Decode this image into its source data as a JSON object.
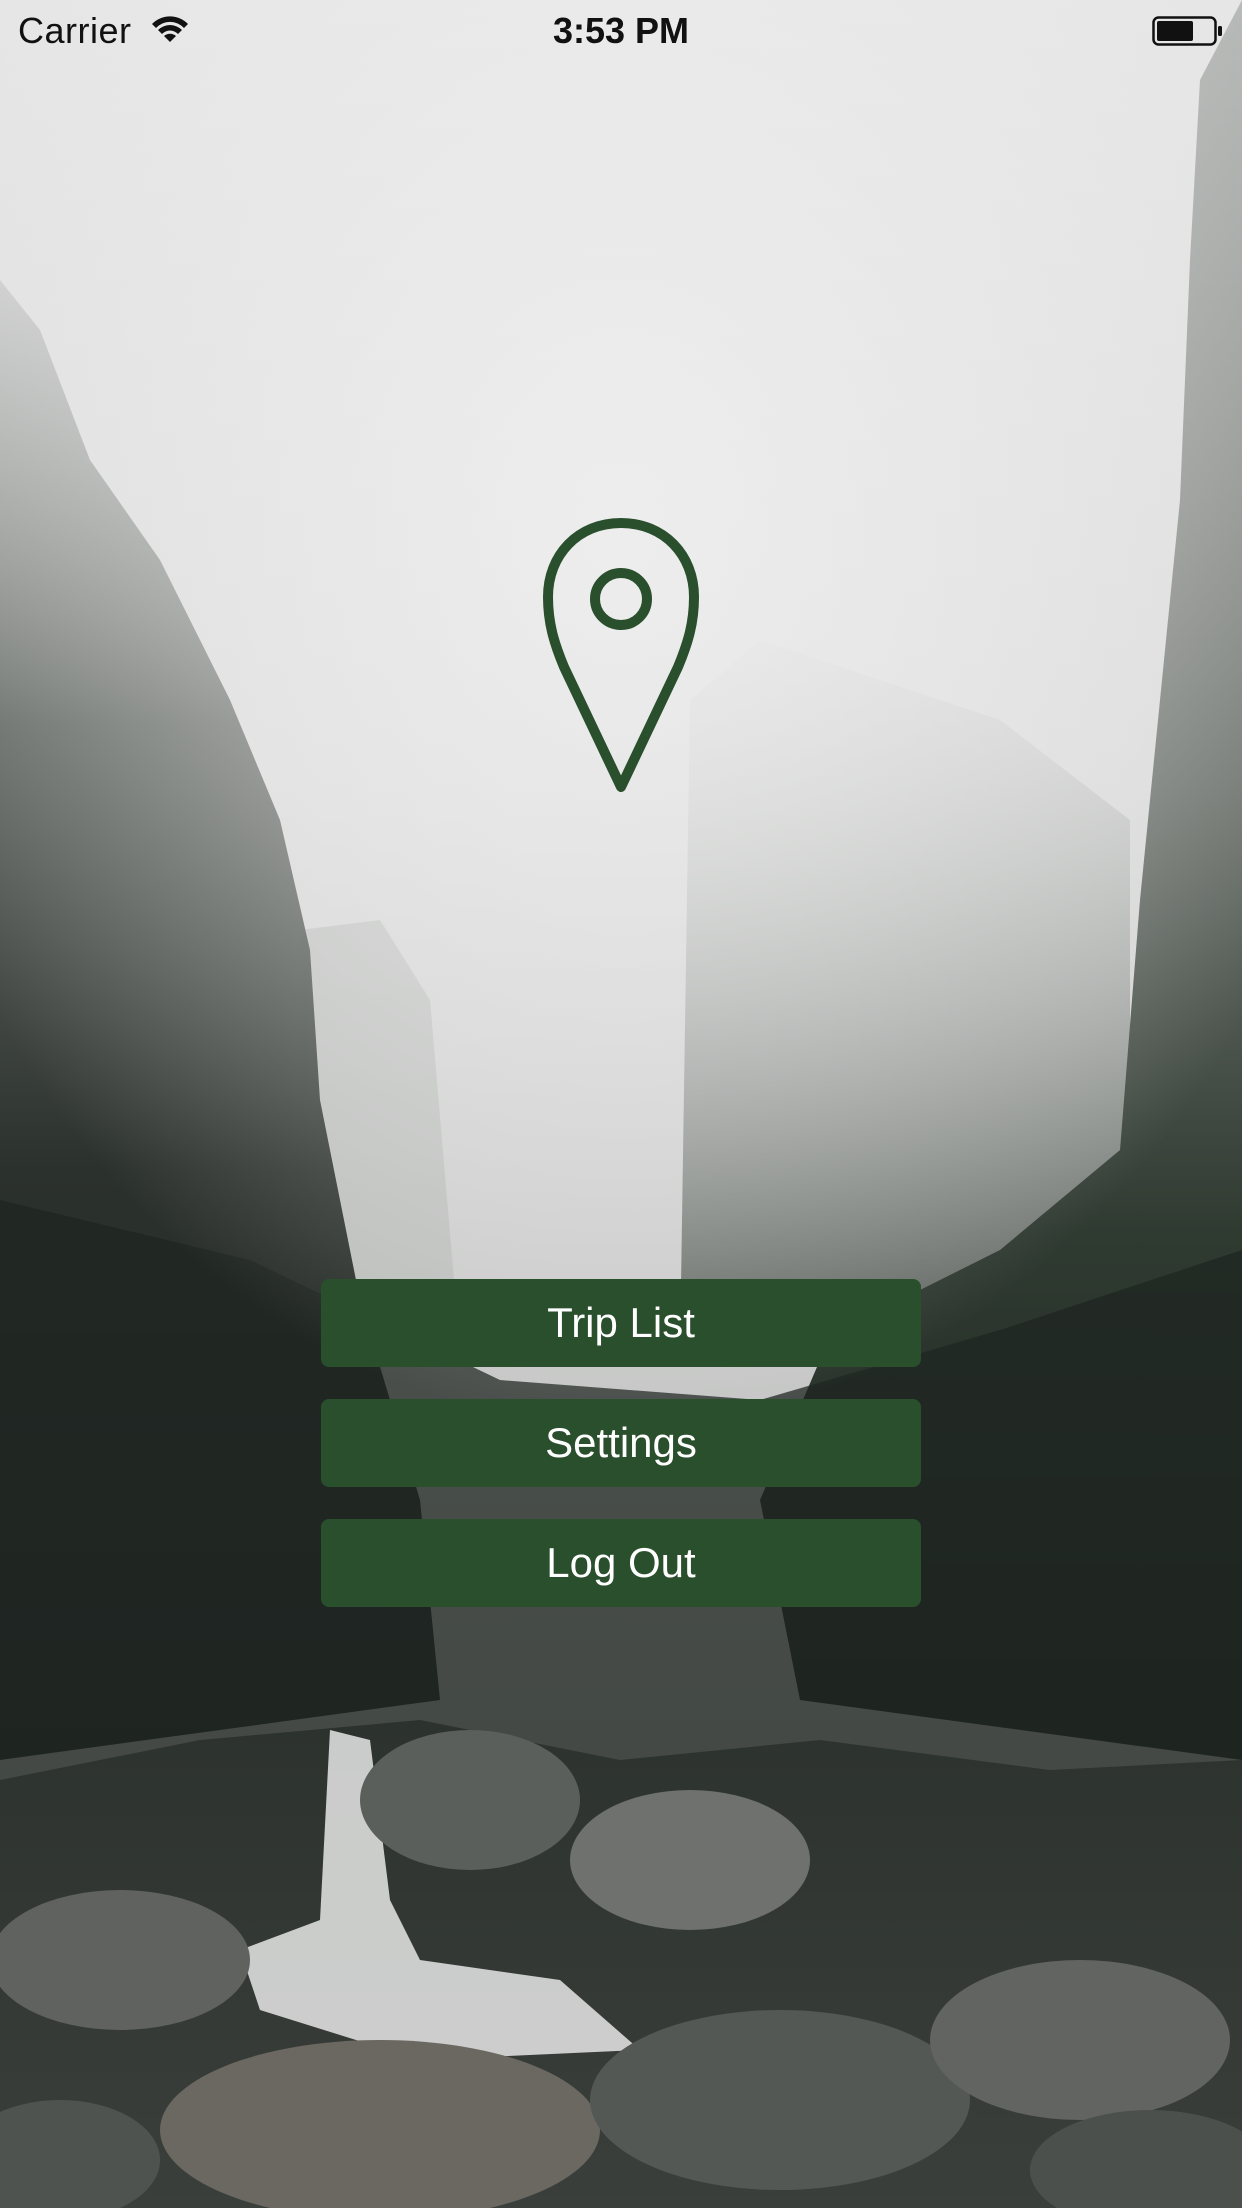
{
  "status_bar": {
    "carrier": "Carrier",
    "time": "3:53 PM"
  },
  "icons": {
    "wifi": "wifi-icon",
    "battery": "battery-icon",
    "logo": "location-pin-icon"
  },
  "menu": {
    "trip_list_label": "Trip List",
    "settings_label": "Settings",
    "log_out_label": "Log Out"
  },
  "colors": {
    "accent": "#2a4f2d",
    "button_text": "#ffffff"
  }
}
